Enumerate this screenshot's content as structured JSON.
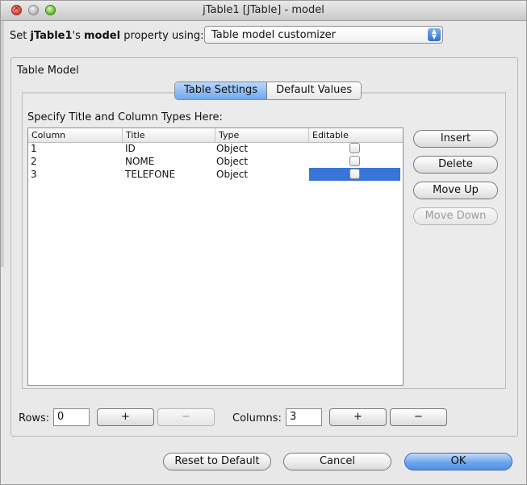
{
  "window": {
    "title": "jTable1 [JTable] - model",
    "close_glyph": "×"
  },
  "property": {
    "prefix": "Set ",
    "component": "jTable1",
    "mid": "'s ",
    "property_name": "model",
    "suffix": " property using:",
    "selector_value": "Table model customizer"
  },
  "panel": {
    "title": "Table Model",
    "tabs": [
      {
        "label": "Table Settings",
        "active": true
      },
      {
        "label": "Default Values",
        "active": false
      }
    ],
    "instruction": "Specify Title and Column Types Here:"
  },
  "table": {
    "headers": [
      "Column",
      "Title",
      "Type",
      "Editable"
    ],
    "rows": [
      {
        "column": "1",
        "title": "ID",
        "type": "Object",
        "editable": false,
        "selected": false
      },
      {
        "column": "2",
        "title": "NOME",
        "type": "Object",
        "editable": false,
        "selected": false
      },
      {
        "column": "3",
        "title": "TELEFONE",
        "type": "Object",
        "editable": false,
        "selected": true
      }
    ]
  },
  "side_buttons": {
    "insert": "Insert",
    "delete": "Delete",
    "move_up": "Move Up",
    "move_down": "Move Down"
  },
  "counts": {
    "rows_label": "Rows:",
    "rows_value": "0",
    "plus": "+",
    "minus": "−",
    "columns_label": "Columns:",
    "columns_value": "3"
  },
  "footer": {
    "reset": "Reset to Default",
    "cancel": "Cancel",
    "ok": "OK"
  },
  "colors": {
    "selection": "#3875d7",
    "accent": "#6fa8ec"
  }
}
